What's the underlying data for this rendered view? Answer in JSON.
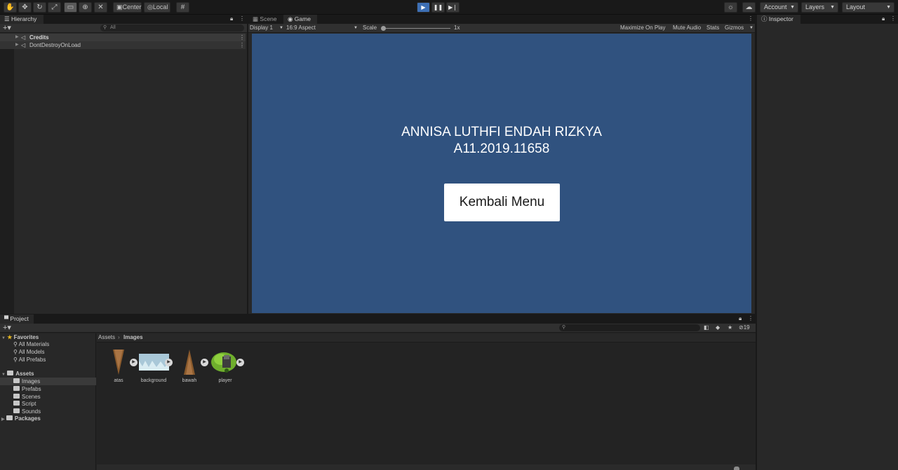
{
  "toolbar": {
    "pivot_center": "Center",
    "pivot_local": "Local",
    "account": "Account",
    "layers": "Layers",
    "layout": "Layout"
  },
  "hierarchy": {
    "tab": "Hierarchy",
    "search_placeholder": "All",
    "items": [
      {
        "label": "Credits"
      },
      {
        "label": "DontDestroyOnLoad"
      }
    ]
  },
  "game_view": {
    "tabs": [
      "Scene",
      "Game"
    ],
    "display": "Display 1",
    "aspect": "16:9 Aspect",
    "scale_label": "Scale",
    "scale_value": "1x",
    "options": [
      "Maximize On Play",
      "Mute Audio",
      "Stats",
      "Gizmos"
    ],
    "canvas_color": "#30527f",
    "name_line": "ANNISA LUTHFI ENDAH RIZKYA",
    "id_line": "A11.2019.11658",
    "button_label": "Kembali Menu"
  },
  "inspector": {
    "tab": "Inspector"
  },
  "project": {
    "tab": "Project",
    "hidden_count": "19",
    "favorites_label": "Favorites",
    "favorites": [
      "All Materials",
      "All Models",
      "All Prefabs"
    ],
    "assets_label": "Assets",
    "asset_folders": [
      "Images",
      "Prefabs",
      "Scenes",
      "Script",
      "Sounds"
    ],
    "packages_label": "Packages",
    "breadcrumb": [
      "Assets",
      "Images"
    ],
    "files": [
      "atas",
      "background",
      "bawah",
      "player"
    ]
  }
}
